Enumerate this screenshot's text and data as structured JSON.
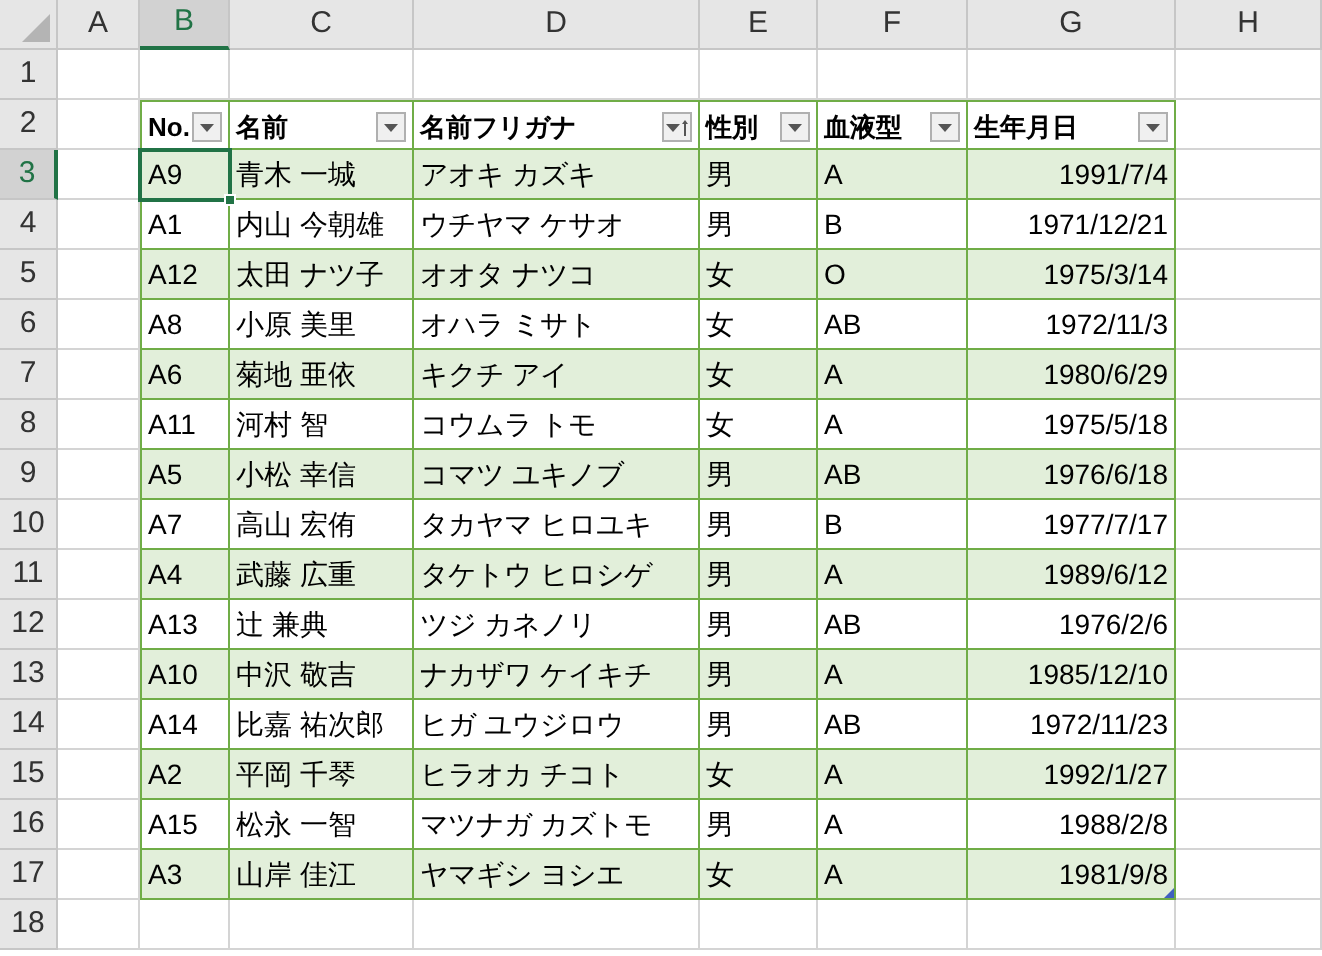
{
  "column_headers": [
    {
      "label": "A",
      "selected": false
    },
    {
      "label": "B",
      "selected": true
    },
    {
      "label": "C",
      "selected": false
    },
    {
      "label": "D",
      "selected": false
    },
    {
      "label": "E",
      "selected": false
    },
    {
      "label": "F",
      "selected": false
    },
    {
      "label": "G",
      "selected": false
    },
    {
      "label": "H",
      "selected": false
    }
  ],
  "row_headers": [
    {
      "label": "1",
      "selected": false
    },
    {
      "label": "2",
      "selected": false
    },
    {
      "label": "3",
      "selected": true
    },
    {
      "label": "4",
      "selected": false
    },
    {
      "label": "5",
      "selected": false
    },
    {
      "label": "6",
      "selected": false
    },
    {
      "label": "7",
      "selected": false
    },
    {
      "label": "8",
      "selected": false
    },
    {
      "label": "9",
      "selected": false
    },
    {
      "label": "10",
      "selected": false
    },
    {
      "label": "11",
      "selected": false
    },
    {
      "label": "12",
      "selected": false
    },
    {
      "label": "13",
      "selected": false
    },
    {
      "label": "14",
      "selected": false
    },
    {
      "label": "15",
      "selected": false
    },
    {
      "label": "16",
      "selected": false
    },
    {
      "label": "17",
      "selected": false
    },
    {
      "label": "18",
      "selected": false
    }
  ],
  "table": {
    "columns": [
      {
        "label": "No.",
        "sorted": false
      },
      {
        "label": "名前",
        "sorted": false
      },
      {
        "label": "名前フリガナ",
        "sorted": true
      },
      {
        "label": "性別",
        "sorted": false
      },
      {
        "label": "血液型",
        "sorted": false
      },
      {
        "label": "生年月日",
        "sorted": false
      }
    ],
    "rows": [
      [
        {
          "text": "A9",
          "selected": true
        },
        {
          "text": "青木 一城",
          "selected": false
        },
        {
          "text": "アオキ カズキ",
          "selected": false
        },
        {
          "text": "男",
          "selected": false
        },
        {
          "text": "A",
          "selected": false
        },
        {
          "text": "1991/7/4",
          "selected": false
        }
      ],
      [
        {
          "text": "A1",
          "selected": false
        },
        {
          "text": "内山 今朝雄",
          "selected": false
        },
        {
          "text": "ウチヤマ ケサオ",
          "selected": false
        },
        {
          "text": "男",
          "selected": false
        },
        {
          "text": "B",
          "selected": false
        },
        {
          "text": "1971/12/21",
          "selected": false
        }
      ],
      [
        {
          "text": "A12",
          "selected": false
        },
        {
          "text": "太田 ナツ子",
          "selected": false
        },
        {
          "text": "オオタ ナツコ",
          "selected": false
        },
        {
          "text": "女",
          "selected": false
        },
        {
          "text": "O",
          "selected": false
        },
        {
          "text": "1975/3/14",
          "selected": false
        }
      ],
      [
        {
          "text": "A8",
          "selected": false
        },
        {
          "text": "小原 美里",
          "selected": false
        },
        {
          "text": "オハラ ミサト",
          "selected": false
        },
        {
          "text": "女",
          "selected": false
        },
        {
          "text": "AB",
          "selected": false
        },
        {
          "text": "1972/11/3",
          "selected": false
        }
      ],
      [
        {
          "text": "A6",
          "selected": false
        },
        {
          "text": "菊地 亜依",
          "selected": false
        },
        {
          "text": "キクチ アイ",
          "selected": false
        },
        {
          "text": "女",
          "selected": false
        },
        {
          "text": "A",
          "selected": false
        },
        {
          "text": "1980/6/29",
          "selected": false
        }
      ],
      [
        {
          "text": "A11",
          "selected": false
        },
        {
          "text": "河村 智",
          "selected": false
        },
        {
          "text": "コウムラ トモ",
          "selected": false
        },
        {
          "text": "女",
          "selected": false
        },
        {
          "text": "A",
          "selected": false
        },
        {
          "text": "1975/5/18",
          "selected": false
        }
      ],
      [
        {
          "text": "A5",
          "selected": false
        },
        {
          "text": "小松 幸信",
          "selected": false
        },
        {
          "text": "コマツ ユキノブ",
          "selected": false
        },
        {
          "text": "男",
          "selected": false
        },
        {
          "text": "AB",
          "selected": false
        },
        {
          "text": "1976/6/18",
          "selected": false
        }
      ],
      [
        {
          "text": "A7",
          "selected": false
        },
        {
          "text": "高山 宏侑",
          "selected": false
        },
        {
          "text": "タカヤマ ヒロユキ",
          "selected": false
        },
        {
          "text": "男",
          "selected": false
        },
        {
          "text": "B",
          "selected": false
        },
        {
          "text": "1977/7/17",
          "selected": false
        }
      ],
      [
        {
          "text": "A4",
          "selected": false
        },
        {
          "text": "武藤 広重",
          "selected": false
        },
        {
          "text": "タケトウ ヒロシゲ",
          "selected": false
        },
        {
          "text": "男",
          "selected": false
        },
        {
          "text": "A",
          "selected": false
        },
        {
          "text": "1989/6/12",
          "selected": false
        }
      ],
      [
        {
          "text": "A13",
          "selected": false
        },
        {
          "text": "辻 兼典",
          "selected": false
        },
        {
          "text": "ツジ カネノリ",
          "selected": false
        },
        {
          "text": "男",
          "selected": false
        },
        {
          "text": "AB",
          "selected": false
        },
        {
          "text": "1976/2/6",
          "selected": false
        }
      ],
      [
        {
          "text": "A10",
          "selected": false
        },
        {
          "text": "中沢 敬吉",
          "selected": false
        },
        {
          "text": "ナカザワ ケイキチ",
          "selected": false
        },
        {
          "text": "男",
          "selected": false
        },
        {
          "text": "A",
          "selected": false
        },
        {
          "text": "1985/12/10",
          "selected": false
        }
      ],
      [
        {
          "text": "A14",
          "selected": false
        },
        {
          "text": "比嘉 祐次郎",
          "selected": false
        },
        {
          "text": "ヒガ ユウジロウ",
          "selected": false
        },
        {
          "text": "男",
          "selected": false
        },
        {
          "text": "AB",
          "selected": false
        },
        {
          "text": "1972/11/23",
          "selected": false
        }
      ],
      [
        {
          "text": "A2",
          "selected": false
        },
        {
          "text": "平岡 千琴",
          "selected": false
        },
        {
          "text": "ヒラオカ チコト",
          "selected": false
        },
        {
          "text": "女",
          "selected": false
        },
        {
          "text": "A",
          "selected": false
        },
        {
          "text": "1992/1/27",
          "selected": false
        }
      ],
      [
        {
          "text": "A15",
          "selected": false
        },
        {
          "text": "松永 一智",
          "selected": false
        },
        {
          "text": "マツナガ カズトモ",
          "selected": false
        },
        {
          "text": "男",
          "selected": false
        },
        {
          "text": "A",
          "selected": false
        },
        {
          "text": "1988/2/8",
          "selected": false
        }
      ],
      [
        {
          "text": "A3",
          "selected": false
        },
        {
          "text": "山岸 佳江",
          "selected": false
        },
        {
          "text": "ヤマギシ ヨシエ",
          "selected": false
        },
        {
          "text": "女",
          "selected": false
        },
        {
          "text": "A",
          "selected": false
        },
        {
          "text": "1981/9/8",
          "selected": false
        }
      ]
    ]
  }
}
